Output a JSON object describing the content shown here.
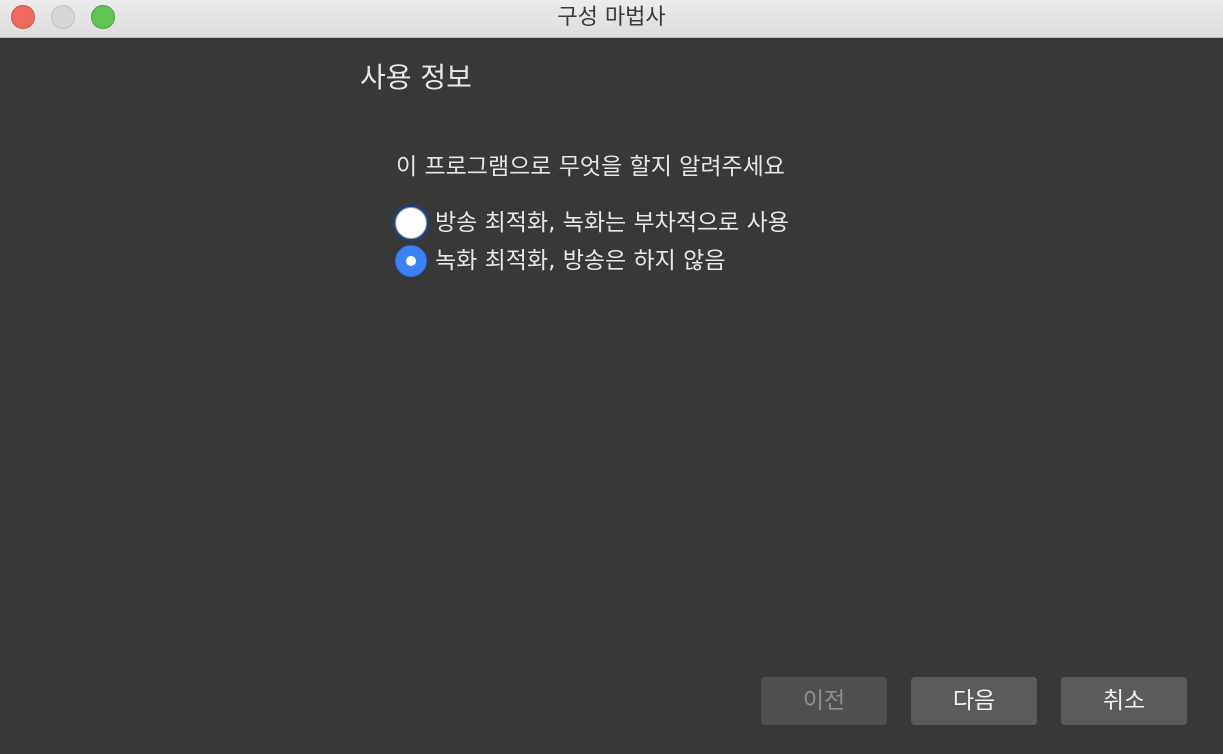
{
  "window": {
    "title": "구성 마법사"
  },
  "page": {
    "heading": "사용 정보",
    "question": "이 프로그램으로 무엇을 할지 알려주세요",
    "options": [
      {
        "label": "방송 최적화, 녹화는 부차적으로 사용",
        "selected": false,
        "focused": true
      },
      {
        "label": "녹화 최적화, 방송은 하지 않음",
        "selected": true,
        "focused": false
      }
    ]
  },
  "buttons": {
    "prev_label": "이전",
    "prev_enabled": false,
    "next_label": "다음",
    "cancel_label": "취소"
  },
  "colors": {
    "background": "#383838",
    "accent": "#3b82f7",
    "focus_ring": "#22406f",
    "close": "#ee6a5f",
    "zoom": "#5fc453"
  }
}
